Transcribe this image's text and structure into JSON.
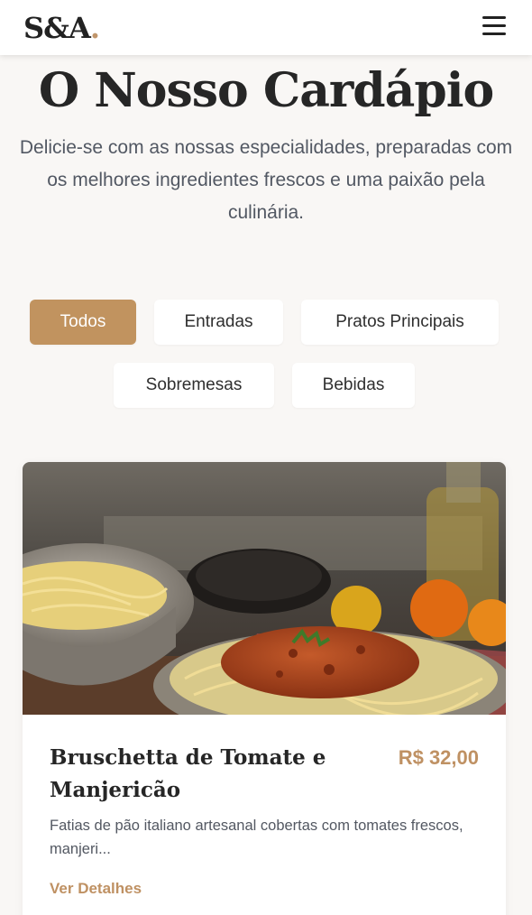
{
  "brand": {
    "logo_text": "S&A",
    "logo_dot": ".",
    "accent_color": "#c1935f"
  },
  "header": {
    "menu_icon": "hamburger-menu-icon"
  },
  "hero": {
    "title": "O Nosso Cardápio",
    "subtitle": "Delicie-se com as nossas especialidades, preparadas com os melhores ingredientes frescos e uma paixão pela culinária."
  },
  "filters": [
    {
      "label": "Todos",
      "active": true
    },
    {
      "label": "Entradas",
      "active": false
    },
    {
      "label": "Pratos Principais",
      "active": false
    },
    {
      "label": "Sobremesas",
      "active": false
    },
    {
      "label": "Bebidas",
      "active": false
    }
  ],
  "menu_items": [
    {
      "image": "spaghetti-bolognese-photo",
      "name": "Bruschetta de Tomate e Manjericão",
      "price": "R$ 32,00",
      "description": "Fatias de pão italiano artesanal cobertas com tomates frescos, manjeri...",
      "link_label": "Ver Detalhes"
    }
  ]
}
